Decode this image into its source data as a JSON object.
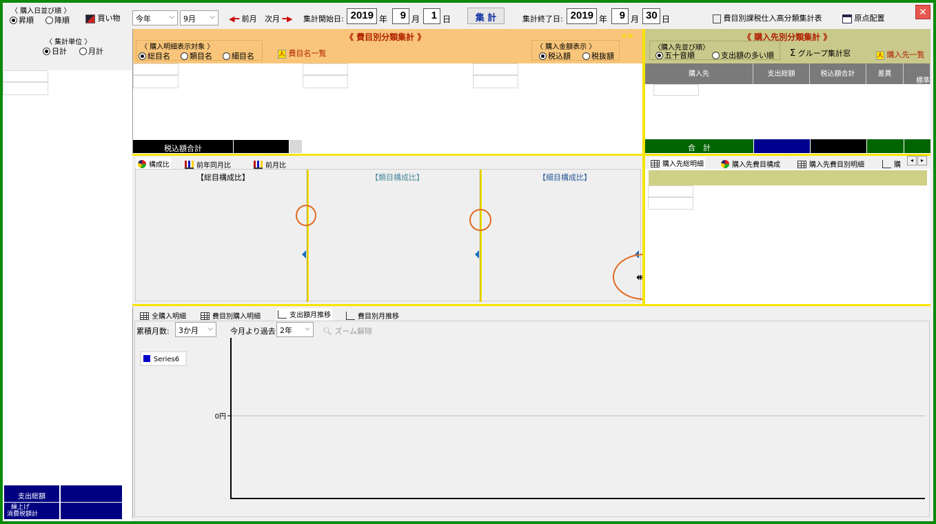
{
  "toolbar": {
    "sort_group_title": "〈 購入日並び順 〉",
    "sort_asc": "昇順",
    "sort_desc": "降順",
    "shopping_label": "買い物",
    "period_select": "今年",
    "month_select": "9月",
    "prev_month": "前月",
    "next_month": "次月",
    "start_label": "集計開始日:",
    "start_year": "2019",
    "start_month": "9",
    "start_day": "1",
    "unit_year": "年",
    "unit_month": "月",
    "unit_day": "日",
    "aggregate_button": "集 計",
    "end_label": "集計終了日:",
    "end_year": "2019",
    "end_month": "9",
    "end_day": "30",
    "report_label": "費目別課税仕入高分類集計表",
    "layout_label": "原点配置",
    "close_label": "✕"
  },
  "left": {
    "unit_group_title": "〈 集計単位 〉",
    "daily": "日計",
    "monthly": "月計",
    "total_spend_label": "支出総額",
    "rounded_label_1": "繰上げ",
    "rounded_label_2": "消費税額計"
  },
  "category_panel": {
    "title": "《 費目別分類集計 》",
    "detail_group_title": "〈 購入明細表示対象 〉",
    "opt_total": "総目名",
    "opt_class": "類目名",
    "opt_detail": "細目名",
    "list_link": "費目名一覧",
    "amount_group_title": "〈 購入金額表示 〉",
    "opt_tax_in": "税込額",
    "opt_tax_out": "税抜額",
    "collapse_glyph": "«»",
    "footer_total": "税込額合計",
    "tabs": [
      "構成比",
      "前年同月比",
      "前月比"
    ],
    "chart_titles": [
      "【総目構成比】",
      "【類目構成比】",
      "【細目構成比】"
    ]
  },
  "vendor_panel": {
    "title": "《 購入先別分類集計 》",
    "order_group_title": "〈購入先並び順〉",
    "opt_kana": "五十音順",
    "opt_spend": "支出額の多い順",
    "group_window": "グループ集計窓",
    "list_link": "購入先一覧",
    "columns": [
      "購入先",
      "支出総額",
      "税込額合計",
      "差異",
      "標準"
    ],
    "footer_total": "合　計",
    "tabs": [
      "購入先総明細",
      "購入先費目構成",
      "購入先費目別明細",
      "購"
    ]
  },
  "bottom_panel": {
    "tabs": [
      "全購入明細",
      "費目別購入明細",
      "支出額月推移",
      "費目別月推移"
    ],
    "months_label": "累積月数:",
    "months_select": "3か月",
    "past_label": "今月より過去",
    "past_select": "2年",
    "zoom_reset": "ズーム解除"
  },
  "chart_data": {
    "type": "line",
    "series": [
      {
        "name": "Series6",
        "values": []
      }
    ],
    "y_tick_labels": [
      "0円"
    ],
    "legend_position": "top-left",
    "colors": {
      "series6": "#0000cc"
    }
  },
  "colors": {
    "frame": "#0b8a0b",
    "orange_header": "#f8c57a",
    "olive_header": "#c9c98b",
    "navy": "#000080",
    "dark_green": "#006400",
    "yellow_splitter": "#f7e400"
  }
}
